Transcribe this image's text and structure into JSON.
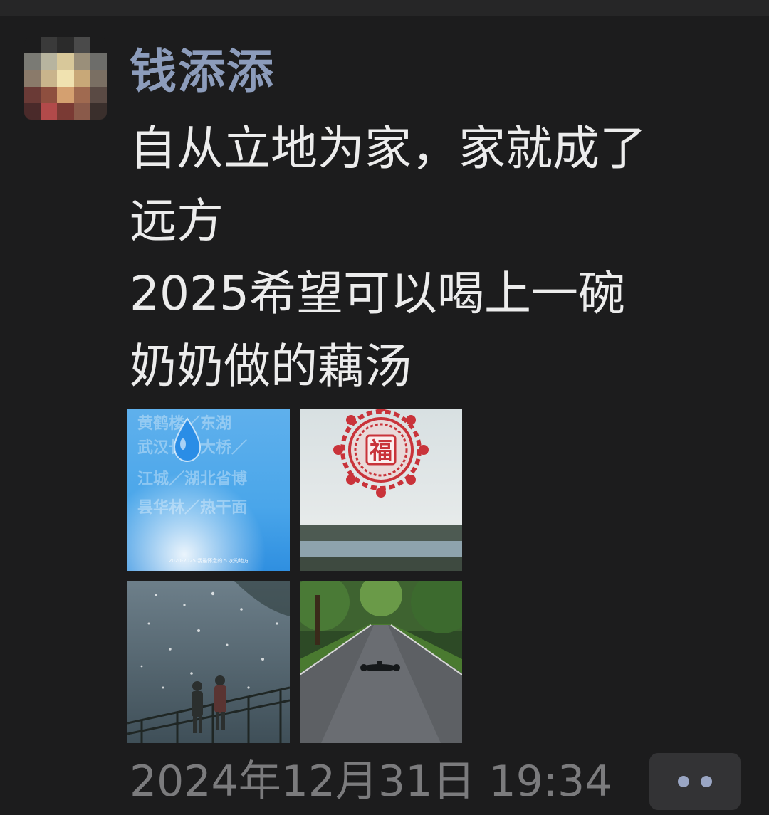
{
  "post": {
    "username": "钱添添",
    "text_lines": [
      "自从立地为家，家就成了",
      "远方",
      "2025希望可以喝上一碗",
      "奶奶做的藕汤"
    ],
    "timestamp": "2024年12月31日 19:34"
  },
  "photos": {
    "photo1": {
      "lines": [
        "黄鹤楼／东湖",
        "武汉长江大桥／",
        "江城／湖北省博",
        "昙华林／热干面"
      ],
      "caption": "2020-2025 我最怀念的 5 次的地方"
    },
    "photo2": {
      "stamp_char": "福"
    }
  },
  "icons": {
    "more": "more-dots-icon",
    "avatar": "blurred-avatar"
  },
  "colors": {
    "background": "#1c1c1d",
    "username": "#8c9cbb",
    "text": "#ececec",
    "timestamp": "#7b7b7d",
    "more_button_bg": "#333335"
  }
}
